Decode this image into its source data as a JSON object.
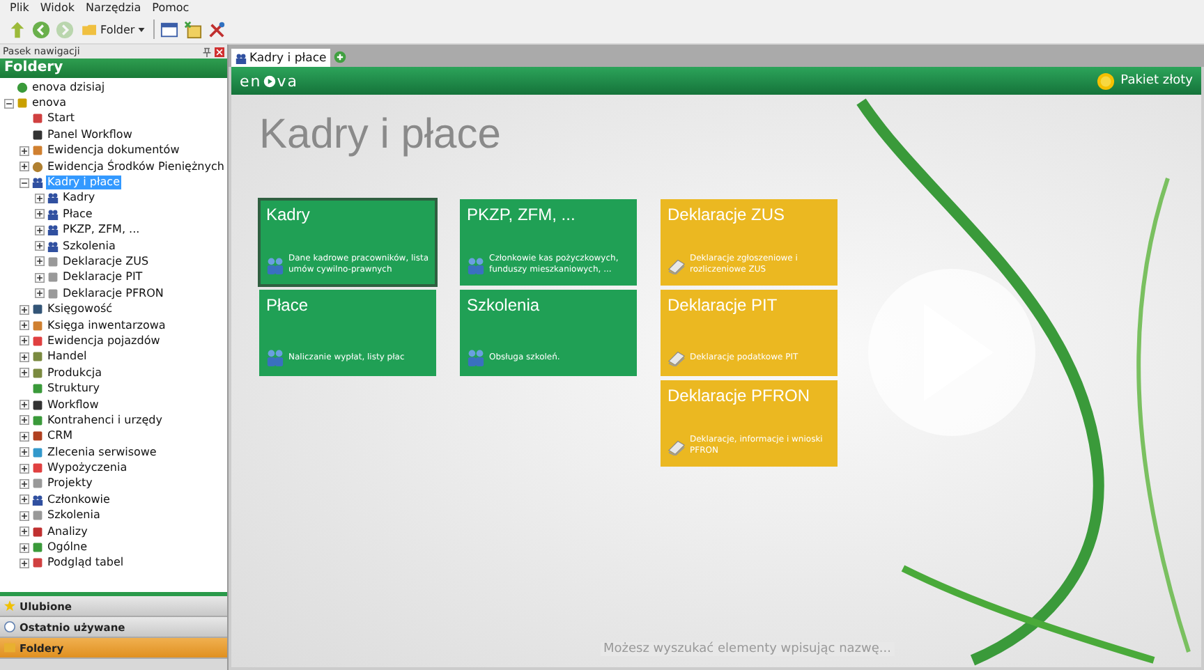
{
  "menu": [
    "Plik",
    "Widok",
    "Narzędzia",
    "Pomoc"
  ],
  "toolbar": {
    "buttons": [
      {
        "kind": "up",
        "disabled": false
      },
      {
        "kind": "back",
        "disabled": false
      },
      {
        "kind": "forward",
        "disabled": true
      }
    ],
    "folder_button": "Folder"
  },
  "navigation": {
    "title": "Pasek nawigacji",
    "header": "Foldery",
    "tree": [
      {
        "label": "enova dzisiaj",
        "kind": "today",
        "selected": false
      },
      {
        "label": "enova",
        "kind": "db",
        "selected": false,
        "expanded": true,
        "children": [
          {
            "label": "Start",
            "kind": "cal",
            "selected": false
          },
          {
            "label": "Panel Workflow",
            "kind": "flow",
            "selected": false
          },
          {
            "label": "Ewidencja dokumentów",
            "kind": "box",
            "selected": false,
            "expanded": false
          },
          {
            "label": "Ewidencja Środków Pieniężnych",
            "kind": "coin",
            "selected": false,
            "expanded": false
          },
          {
            "label": "Kadry i płace",
            "kind": "people",
            "selected": true,
            "expanded": true,
            "children": [
              {
                "label": "Kadry",
                "kind": "people",
                "selected": false,
                "expanded": false
              },
              {
                "label": "Płace",
                "kind": "people",
                "selected": false,
                "expanded": false
              },
              {
                "label": "PKZP, ZFM, ...",
                "kind": "people",
                "selected": false,
                "expanded": false
              },
              {
                "label": "Szkolenia",
                "kind": "people",
                "selected": false,
                "expanded": false
              },
              {
                "label": "Deklaracje ZUS",
                "kind": "doc",
                "selected": false,
                "expanded": false
              },
              {
                "label": "Deklaracje PIT",
                "kind": "doc",
                "selected": false,
                "expanded": false
              },
              {
                "label": "Deklaracje PFRON",
                "kind": "doc",
                "selected": false,
                "expanded": false
              }
            ]
          },
          {
            "label": "Księgowość",
            "kind": "book",
            "selected": false,
            "expanded": false
          },
          {
            "label": "Księga inwentarzowa",
            "kind": "box",
            "selected": false,
            "expanded": false
          },
          {
            "label": "Ewidencja pojazdów",
            "kind": "car",
            "selected": false,
            "expanded": false
          },
          {
            "label": "Handel",
            "kind": "bag",
            "selected": false,
            "expanded": false
          },
          {
            "label": "Produkcja",
            "kind": "bag",
            "selected": false,
            "expanded": false
          },
          {
            "label": "Struktury",
            "kind": "tree",
            "selected": false
          },
          {
            "label": "Workflow",
            "kind": "flow",
            "selected": false,
            "expanded": false
          },
          {
            "label": "Kontrahenci i urzędy",
            "kind": "leaf",
            "selected": false,
            "expanded": false
          },
          {
            "label": "CRM",
            "kind": "phone",
            "selected": false,
            "expanded": false
          },
          {
            "label": "Zlecenia serwisowe",
            "kind": "wrench",
            "selected": false,
            "expanded": false
          },
          {
            "label": "Wypożyczenia",
            "kind": "car",
            "selected": false,
            "expanded": false
          },
          {
            "label": "Projekty",
            "kind": "doc",
            "selected": false,
            "expanded": false
          },
          {
            "label": "Członkowie",
            "kind": "people",
            "selected": false,
            "expanded": false
          },
          {
            "label": "Szkolenia",
            "kind": "doc",
            "selected": false,
            "expanded": false
          },
          {
            "label": "Analizy",
            "kind": "chart",
            "selected": false,
            "expanded": false
          },
          {
            "label": "Ogólne",
            "kind": "leaf",
            "selected": false,
            "expanded": false
          },
          {
            "label": "Podgląd tabel",
            "kind": "cal",
            "selected": false,
            "expanded": false
          }
        ]
      }
    ],
    "sections": [
      {
        "label": "Ulubione",
        "kind": "star",
        "selected": false
      },
      {
        "label": "Ostatnio używane",
        "kind": "clock",
        "selected": false
      },
      {
        "label": "Foldery",
        "kind": "folder",
        "selected": true
      }
    ]
  },
  "tabs": [
    {
      "label": "Kadry i płace",
      "selected": true
    }
  ],
  "banner": {
    "logo_left": "en",
    "logo_right": "va",
    "package": "Pakiet złoty"
  },
  "page_title": "Kadry i płace",
  "tile_columns": [
    [
      {
        "title": "Kadry",
        "desc": "Dane kadrowe pracowników, lista umów cywilno-prawnych",
        "color": "#20a055",
        "kind": "people",
        "selected": true
      },
      {
        "title": "Płace",
        "desc": "Naliczanie wypłat, listy płac",
        "color": "#20a055",
        "kind": "people",
        "selected": false
      }
    ],
    [
      {
        "title": "PKZP, ZFM, ...",
        "desc": "Członkowie kas pożyczkowych, funduszy mieszkaniowych, ...",
        "color": "#20a055",
        "kind": "people",
        "selected": false
      },
      {
        "title": "Szkolenia",
        "desc": "Obsługa szkoleń.",
        "color": "#20a055",
        "kind": "people",
        "selected": false
      }
    ],
    [
      {
        "title": "Deklaracje ZUS",
        "desc": "Deklaracje zgłoszeniowe i rozliczeniowe ZUS",
        "color": "#ebb821",
        "kind": "doc",
        "selected": false
      },
      {
        "title": "Deklaracje PIT",
        "desc": "Deklaracje podatkowe PIT",
        "color": "#ebb821",
        "kind": "doc",
        "selected": false
      },
      {
        "title": "Deklaracje PFRON",
        "desc": "Deklaracje, informacje i wnioski PFRON",
        "color": "#ebb821",
        "kind": "doc",
        "selected": false
      }
    ]
  ],
  "search_hint": "Możesz wyszukać elementy wpisując nazwę..."
}
